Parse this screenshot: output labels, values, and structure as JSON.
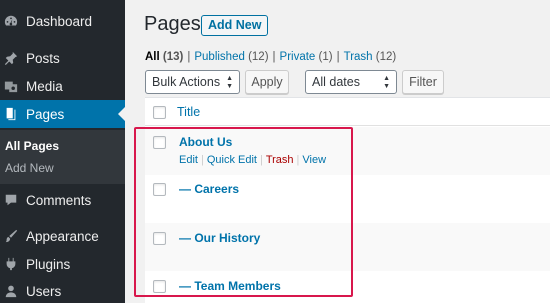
{
  "sidebar": {
    "items": [
      {
        "label": "Dashboard",
        "icon": "dashboard-icon"
      },
      {
        "label": "Posts",
        "icon": "pin-icon"
      },
      {
        "label": "Media",
        "icon": "media-icon"
      },
      {
        "label": "Pages",
        "icon": "pages-icon",
        "active": true
      },
      {
        "label": "Comments",
        "icon": "comment-icon"
      },
      {
        "label": "Appearance",
        "icon": "paintbrush-icon"
      },
      {
        "label": "Plugins",
        "icon": "plugin-icon"
      },
      {
        "label": "Users",
        "icon": "user-icon"
      }
    ],
    "submenu": [
      {
        "label": "All Pages",
        "current": true
      },
      {
        "label": "Add New"
      }
    ]
  },
  "header": {
    "title": "Pages",
    "add_new": "Add New"
  },
  "filters_links": [
    {
      "label": "All",
      "count": "(13)",
      "current": true
    },
    {
      "label": "Published",
      "count": "(12)"
    },
    {
      "label": "Private",
      "count": "(1)"
    },
    {
      "label": "Trash",
      "count": "(12)"
    }
  ],
  "separator": "|",
  "toolbar": {
    "bulk_actions": "Bulk Actions",
    "apply": "Apply",
    "dates": "All dates",
    "filter": "Filter"
  },
  "table": {
    "column_title": "Title",
    "rows": [
      {
        "title": "About Us",
        "actions": [
          "Edit",
          "Quick Edit",
          "Trash",
          "View"
        ]
      },
      {
        "title": "— Careers"
      },
      {
        "title": "— Our History"
      },
      {
        "title": "— Team Members"
      }
    ]
  },
  "colors": {
    "sidebar_bg": "#23282d",
    "active_bg": "#0073aa",
    "link": "#0073aa",
    "trash": "#aa0000",
    "highlight": "#d8174c"
  }
}
